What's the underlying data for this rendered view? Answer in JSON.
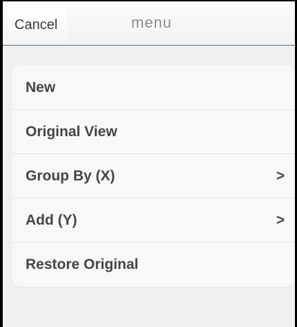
{
  "navbar": {
    "cancel_label": "Cancel",
    "title": "menu"
  },
  "menu": {
    "items": [
      {
        "label": "New",
        "chevron": ""
      },
      {
        "label": "Original View",
        "chevron": ""
      },
      {
        "label": "Group By (X)",
        "chevron": ">"
      },
      {
        "label": "Add (Y)",
        "chevron": ">"
      },
      {
        "label": "Restore Original",
        "chevron": ""
      }
    ]
  },
  "colors": {
    "background": "#f0f0f0",
    "navbar_border": "#586f88",
    "item_text": "#454545",
    "title_text": "#8d8d8d"
  }
}
